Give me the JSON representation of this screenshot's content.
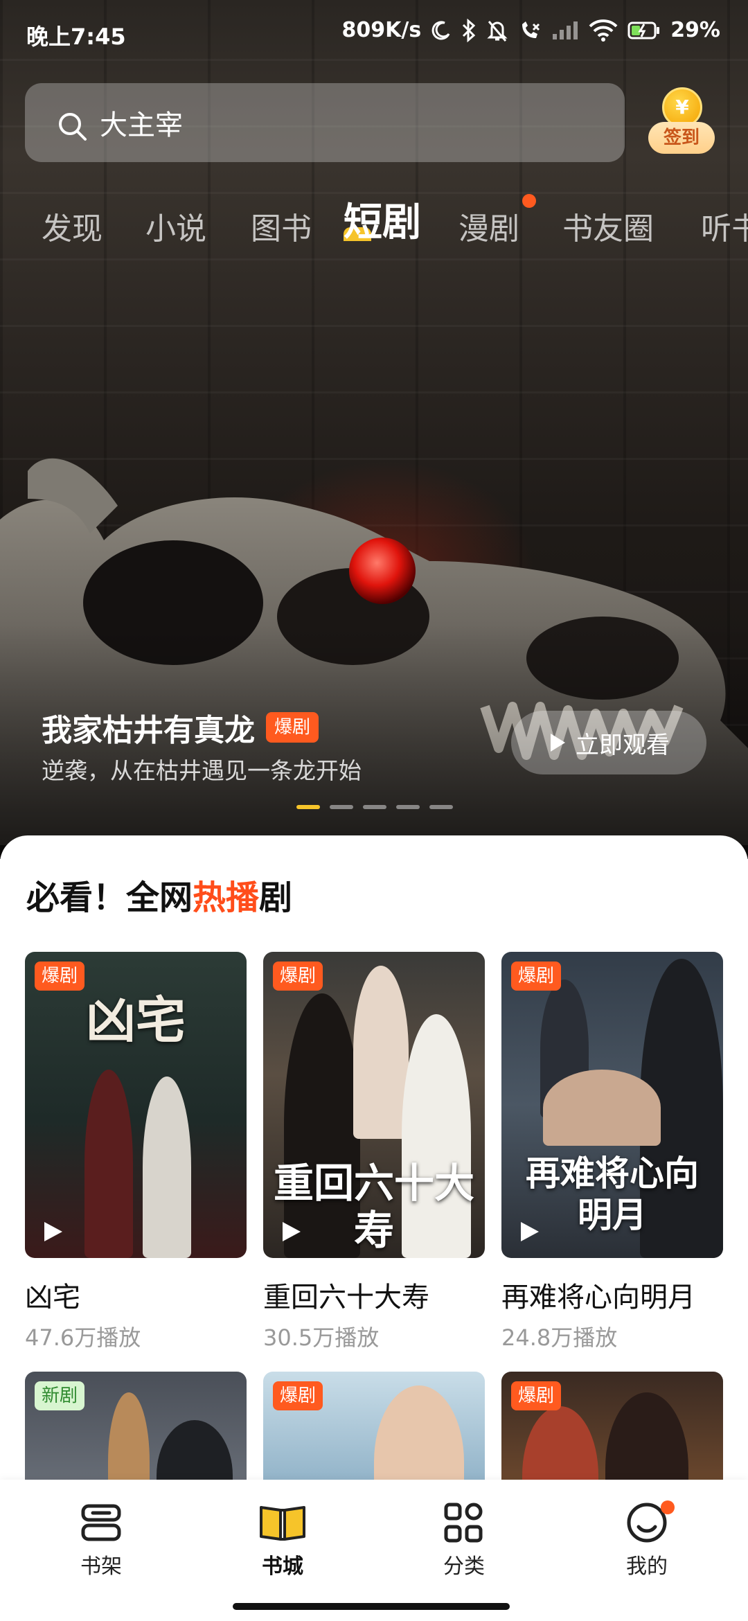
{
  "status_bar": {
    "time": "晚上7:45",
    "network_speed": "809K/s",
    "battery": "29%"
  },
  "search": {
    "query": "大主宰",
    "checkin_icon": "¥",
    "checkin_label": "签到"
  },
  "tabs": [
    "发现",
    "小说",
    "图书",
    "短剧",
    "漫剧",
    "书友圈",
    "听书"
  ],
  "active_tab": "短剧",
  "banner": {
    "title": "我家枯井有真龙",
    "tag": "爆剧",
    "subtitle": "逆袭，从在枯井遇见一条龙开始",
    "watch_button": "立即观看",
    "page_count": 5,
    "active_page": 1
  },
  "section": {
    "title_prefix": "必看！全网",
    "title_hot": "热播",
    "title_suffix": "剧"
  },
  "dramas": [
    {
      "name": "凶宅",
      "views": "47.6万播放",
      "tag": "爆剧",
      "poster_title": "凶宅"
    },
    {
      "name": "重回六十大寿",
      "views": "30.5万播放",
      "tag": "爆剧",
      "poster_title": "重回六十大寿"
    },
    {
      "name": "再难将心向明月",
      "views": "24.8万播放",
      "tag": "爆剧",
      "poster_title": "再难将心向明月"
    },
    {
      "tag": "新剧"
    },
    {
      "tag": "爆剧"
    },
    {
      "tag": "爆剧"
    }
  ],
  "bottom_nav": [
    {
      "label": "书架",
      "icon": "bookshelf-icon"
    },
    {
      "label": "书城",
      "icon": "open-book-icon"
    },
    {
      "label": "分类",
      "icon": "grid-icon"
    },
    {
      "label": "我的",
      "icon": "profile-icon"
    }
  ],
  "active_nav": "书城",
  "colors": {
    "accent_orange": "#ff5a1f",
    "accent_yellow": "#f6c42a",
    "hot_text": "#ff4d1a"
  }
}
